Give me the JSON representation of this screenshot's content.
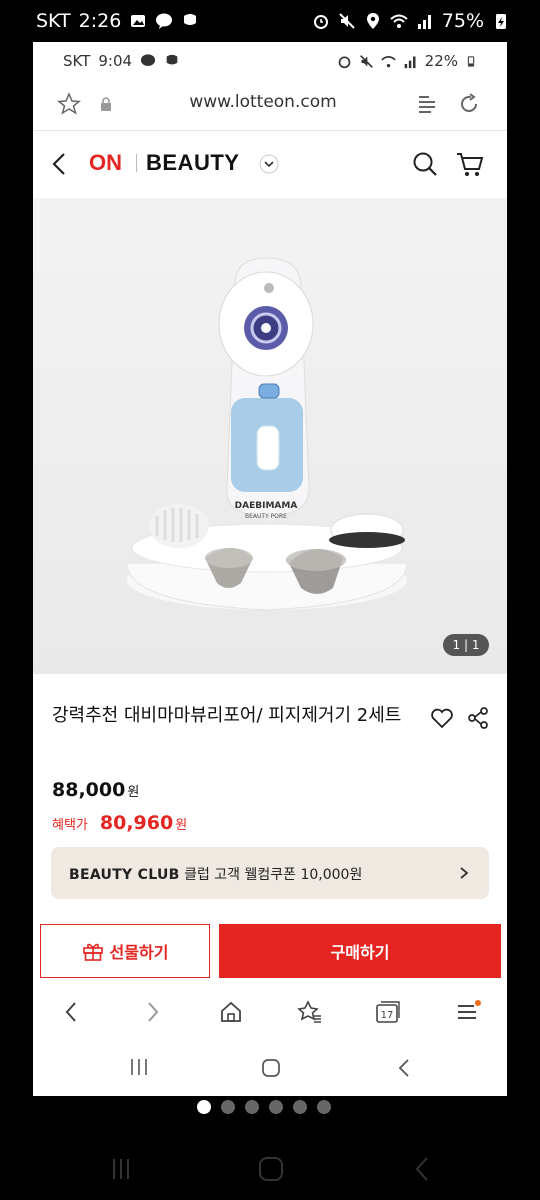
{
  "outer_status": {
    "carrier": "SKT",
    "time": "2:26",
    "battery": "75%"
  },
  "inner_status": {
    "carrier": "SKT",
    "time": "9:04",
    "battery": "22%"
  },
  "browser": {
    "url": "www.lotteon.com"
  },
  "header": {
    "logo_on": "ON",
    "logo_section": "BEAUTY"
  },
  "product": {
    "image_counter": "1 | 1",
    "title": "강력추천 대비마마뷰리포어/ 피지제거기 2세트",
    "price": "88,000",
    "price_unit": "원",
    "benefit_label": "혜택가",
    "benefit_price": "80,960",
    "benefit_unit": "원",
    "device_brand": "DAEBIMAMA",
    "device_model": "BEAUTY PORE"
  },
  "club_banner": {
    "brand": "BEAUTY CLUB",
    "text": "클럽 고객 웰컴쿠폰 10,000원"
  },
  "actions": {
    "gift_label": "선물하기",
    "buy_label": "구매하기"
  },
  "colors": {
    "accent": "#e52521",
    "club_bg": "#efe9e2"
  },
  "page_indicator": {
    "count": 6,
    "active_index": 0
  }
}
